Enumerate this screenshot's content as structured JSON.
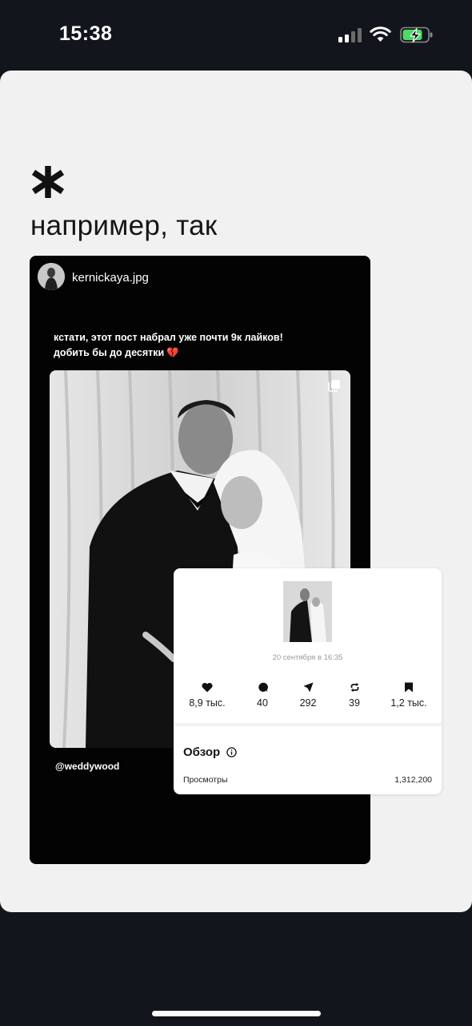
{
  "status_bar": {
    "time": "15:38"
  },
  "story": {
    "headline": "например, так",
    "post": {
      "username": "kernickaya.jpg",
      "caption_line1": "кстати, этот пост набрал уже почти 9к лайков!",
      "caption_line2": "добить бы до десятки",
      "caption_emoji": "💔",
      "credit": "@weddywood"
    },
    "insights": {
      "date": "20 сентября в 16:35",
      "stats": [
        {
          "icon": "heart-icon",
          "value": "8,9 тыс."
        },
        {
          "icon": "comment-icon",
          "value": "40"
        },
        {
          "icon": "send-icon",
          "value": "292"
        },
        {
          "icon": "repost-icon",
          "value": "39"
        },
        {
          "icon": "bookmark-icon",
          "value": "1,2 тыс."
        }
      ],
      "overview_title": "Обзор",
      "views_label": "Просмотры",
      "views_value": "1,312,200"
    }
  },
  "colors": {
    "background": "#12161c",
    "story_card": "#f1f1f1",
    "post_panel": "#030303",
    "battery_charge": "#4cd964"
  }
}
